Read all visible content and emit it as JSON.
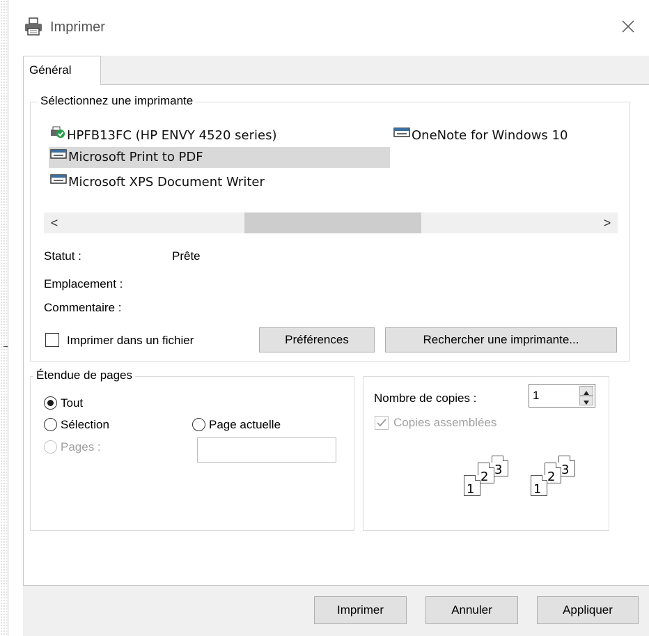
{
  "window": {
    "title": "Imprimer"
  },
  "tabs": [
    {
      "label": "Général"
    }
  ],
  "printer_group": {
    "legend": "Sélectionnez une imprimante",
    "printers": [
      {
        "name": "HPFB13FC (HP ENVY 4520 series)",
        "icon": "printer-default-icon",
        "selected": false
      },
      {
        "name": "Microsoft Print to PDF",
        "icon": "printer-icon",
        "selected": true
      },
      {
        "name": "Microsoft XPS Document Writer",
        "icon": "printer-icon",
        "selected": false
      },
      {
        "name": "OneNote for Windows 10",
        "icon": "printer-icon",
        "selected": false
      }
    ],
    "scroll_left": "<",
    "scroll_right": ">",
    "status_label": "Statut :",
    "status_value": "Prête",
    "location_label": "Emplacement :",
    "comment_label": "Commentaire :",
    "print_to_file_label": "Imprimer dans un fichier",
    "preferences_label": "Préférences",
    "find_printer_label": "Rechercher une imprimante..."
  },
  "page_range": {
    "legend": "Étendue de pages",
    "all_label": "Tout",
    "selection_label": "Sélection",
    "current_page_label": "Page actuelle",
    "pages_label": "Pages :",
    "selected": "all"
  },
  "copies": {
    "count_label": "Nombre de copies :",
    "count_value": "1",
    "collate_label": "Copies assemblées",
    "collate_checked": true,
    "sheets": [
      "1",
      "2",
      "3"
    ]
  },
  "footer": {
    "print_label": "Imprimer",
    "cancel_label": "Annuler",
    "apply_label": "Appliquer"
  },
  "colors": {
    "selection_bg": "#d9d9d9",
    "status_ok": "#22a046",
    "button_bg": "#e1e1e1"
  }
}
